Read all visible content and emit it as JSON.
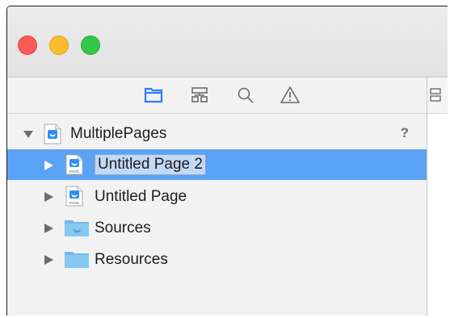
{
  "window": {
    "title_controls": [
      "close",
      "minimize",
      "zoom"
    ]
  },
  "navigator_toolbar": {
    "icons": [
      "folder-icon",
      "hierarchy-icon",
      "search-icon",
      "warning-icon"
    ],
    "active": "folder-icon",
    "accent_color": "#2f7cf6"
  },
  "tree": {
    "root": {
      "label": "MultiplePages",
      "badge": "?",
      "expanded": true,
      "icon": "swift-playground-icon"
    },
    "items": [
      {
        "label": "Untitled Page 2",
        "icon": "swift-page-icon",
        "icon_text": "PAGE",
        "selected": true,
        "editing": true
      },
      {
        "label": "Untitled Page",
        "icon": "swift-page-icon",
        "icon_text": "PAGE",
        "selected": false
      },
      {
        "label": "Sources",
        "icon": "swift-folder-icon",
        "selected": false
      },
      {
        "label": "Resources",
        "icon": "folder-icon",
        "selected": false
      }
    ]
  },
  "colors": {
    "selection": "#5aa2f6",
    "folder": "#7cc3ef",
    "swift": "#f05138"
  }
}
